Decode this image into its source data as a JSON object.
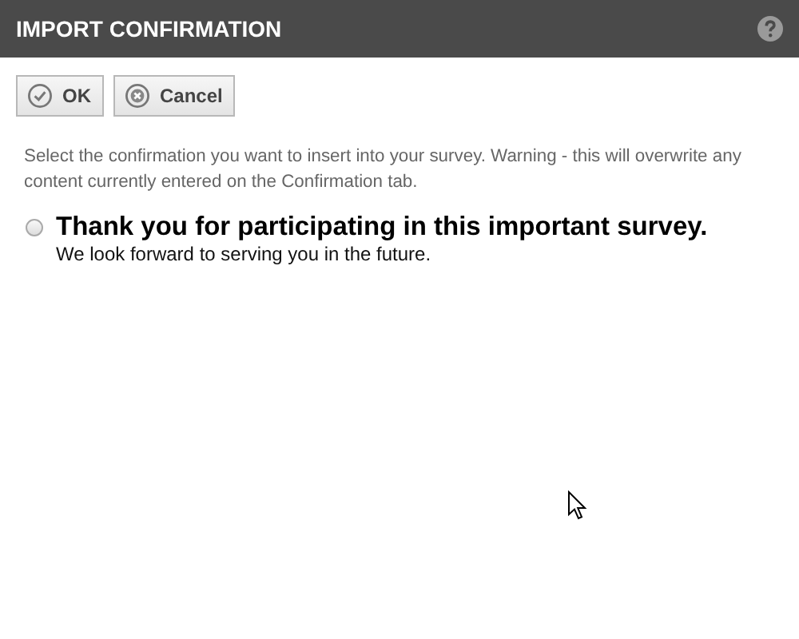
{
  "window": {
    "title": "IMPORT CONFIRMATION"
  },
  "buttons": [
    {
      "label": "OK",
      "kind": "ok"
    },
    {
      "label": "Cancel",
      "kind": "cancel"
    }
  ],
  "instructions": "Select the confirmation you want to insert into your survey. Warning - this will overwrite any content currently entered on the Confirmation tab.",
  "options": [
    {
      "title": "Thank you for participating in this important survey.",
      "subtitle": "We look forward to serving you in the future.",
      "selected": false
    }
  ]
}
